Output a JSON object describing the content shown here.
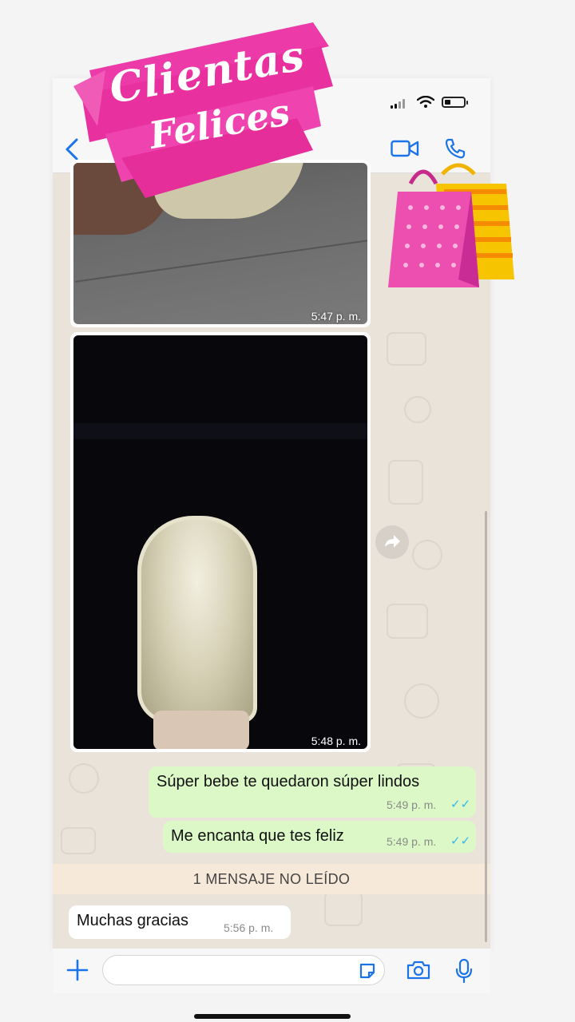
{
  "banner": {
    "line1": "Clientas",
    "line2": "Felices"
  },
  "messages": [
    {
      "type": "image",
      "time": "5:47 p. m."
    },
    {
      "type": "image",
      "time": "5:48 p. m."
    },
    {
      "type": "text",
      "direction": "out",
      "text": "Súper bebe te quedaron súper lindos",
      "time": "5:49 p. m.",
      "status": "read"
    },
    {
      "type": "text",
      "direction": "out",
      "text": "Me encanta que tes feliz",
      "time": "5:49 p. m.",
      "status": "read"
    },
    {
      "type": "text",
      "direction": "in",
      "text": "Muchas gracias",
      "time": "5:56 p. m."
    }
  ],
  "unread_banner": "1 MENSAJE NO LEÍDO",
  "ticks_glyph": "✓✓",
  "icons": [
    "back-chevron-icon",
    "video-call-icon",
    "voice-call-icon",
    "forward-icon",
    "plus-icon",
    "sticker-icon",
    "camera-icon",
    "microphone-icon",
    "shopping-bags-icon"
  ],
  "colors": {
    "accent": "#1a73e8",
    "outgoing_bubble": "#dcf8c6",
    "banner_pink": "#ec3aa8",
    "read_ticks": "#34b7f1"
  }
}
